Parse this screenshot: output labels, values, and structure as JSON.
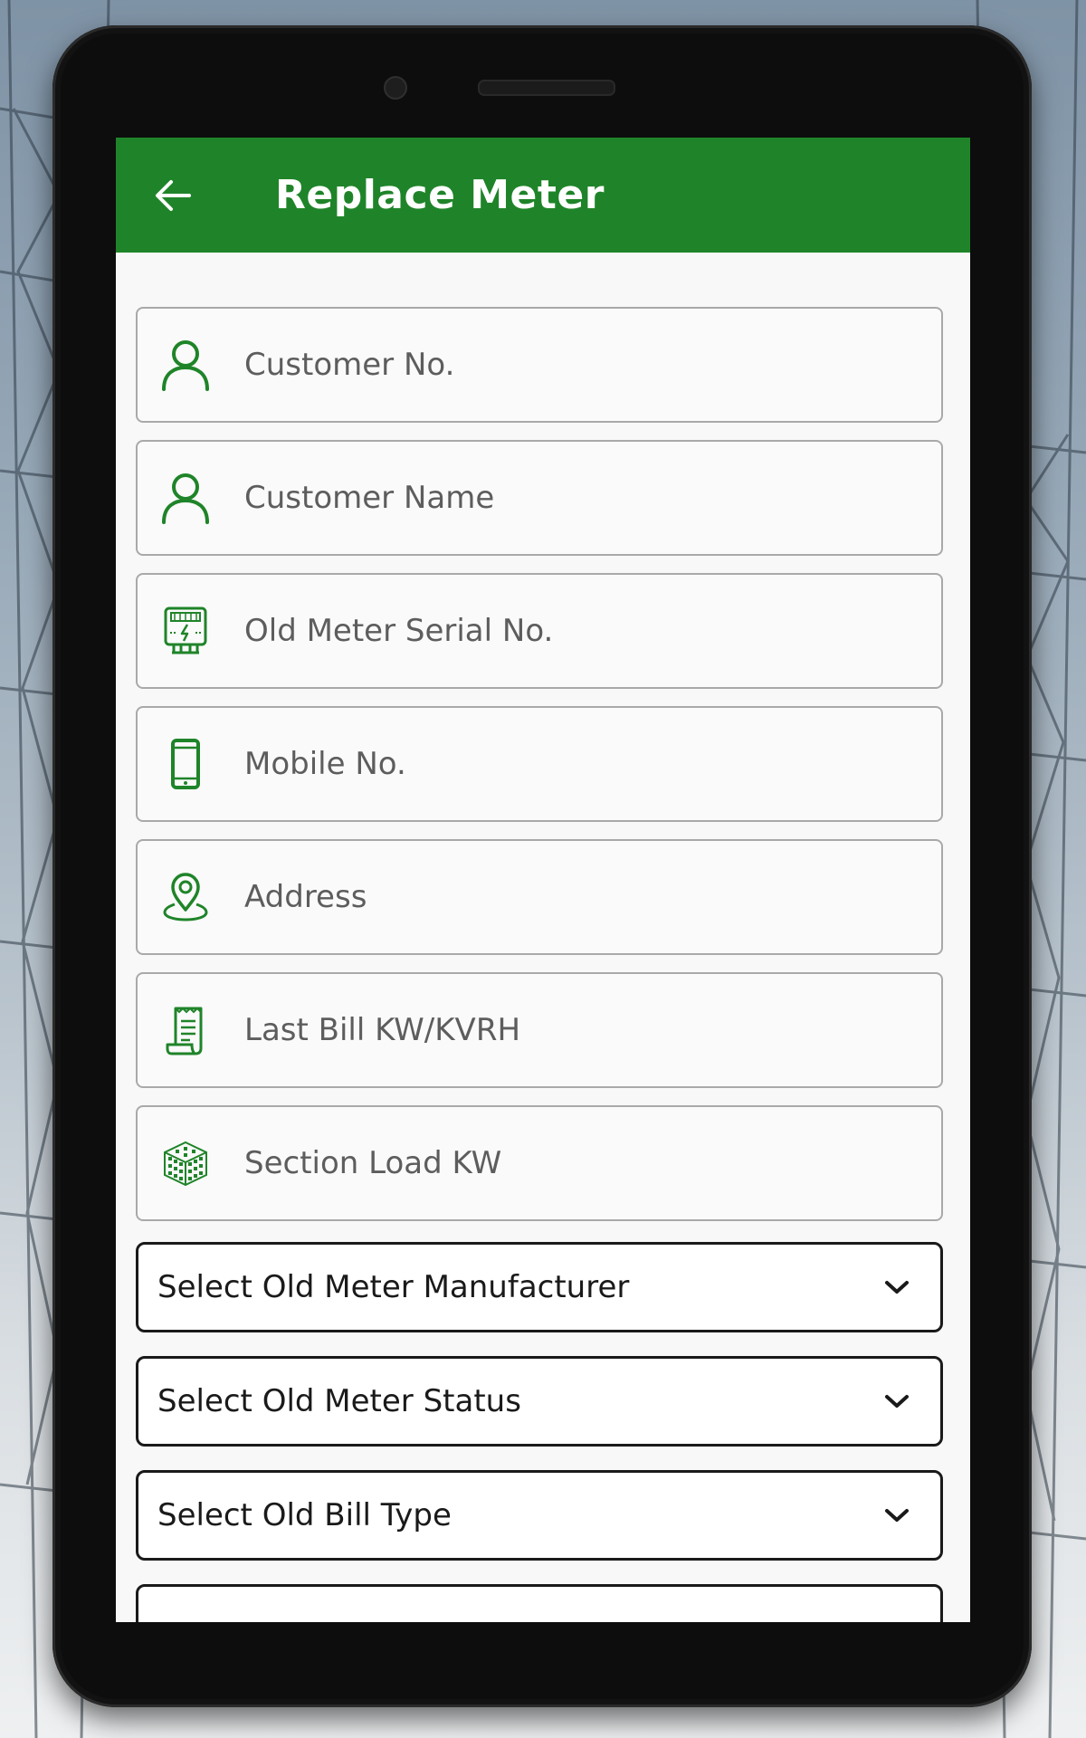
{
  "screen": {
    "title": "Replace Meter",
    "back_icon": "arrow-left-icon"
  },
  "colors": {
    "appbar": "#1f8429",
    "icon_green": "#1f8429",
    "placeholder": "#5d5d5d",
    "field_border": "#a9a9a9",
    "select_border": "#1a1a1a"
  },
  "fields": [
    {
      "icon": "user-icon",
      "placeholder": "Customer No."
    },
    {
      "icon": "user-icon",
      "placeholder": "Customer Name"
    },
    {
      "icon": "meter-icon",
      "placeholder": "Old Meter Serial No."
    },
    {
      "icon": "mobile-phone-icon",
      "placeholder": "Mobile No."
    },
    {
      "icon": "location-pin-icon",
      "placeholder": "Address"
    },
    {
      "icon": "receipt-icon",
      "placeholder": "Last Bill KW/KVRH"
    },
    {
      "icon": "grid-cube-icon",
      "placeholder": "Section Load KW"
    }
  ],
  "dropdowns": [
    {
      "label": "Select Old Meter Manufacturer",
      "icon": "chevron-down-icon"
    },
    {
      "label": "Select Old Meter Status",
      "icon": "chevron-down-icon"
    },
    {
      "label": "Select Old Bill Type",
      "icon": "chevron-down-icon"
    }
  ]
}
